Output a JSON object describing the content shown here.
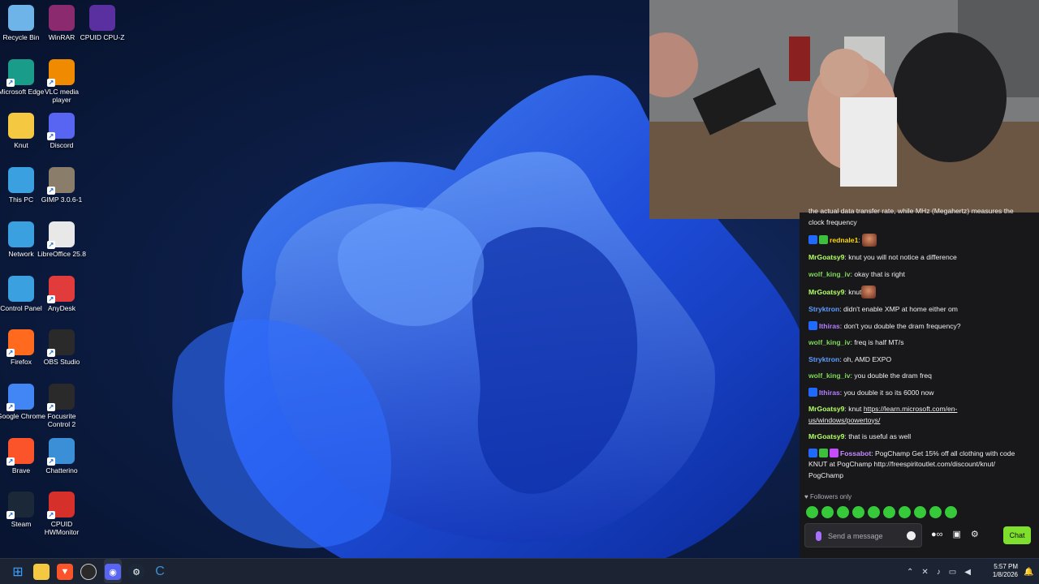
{
  "desktop": {
    "icons": [
      {
        "label": "Recycle Bin",
        "icon": "recycle-bin-icon",
        "color": "#6fb4e8"
      },
      {
        "label": "WinRAR",
        "icon": "winrar-icon",
        "color": "#8b2a6e"
      },
      {
        "label": "CPUID CPU-Z",
        "icon": "cpuz-icon",
        "color": "#5a2fa0"
      },
      {
        "label": "Microsoft Edge",
        "icon": "edge-icon",
        "color": "#1a9c8a"
      },
      {
        "label": "VLC media player",
        "icon": "vlc-icon",
        "color": "#f08a00"
      },
      {
        "label": "Knut",
        "icon": "folder-icon",
        "color": "#f5c842"
      },
      {
        "label": "Discord",
        "icon": "discord-icon",
        "color": "#5865f2"
      },
      {
        "label": "This PC",
        "icon": "monitor-icon",
        "color": "#3aa0e0"
      },
      {
        "label": "GIMP 3.0.6-1",
        "icon": "gimp-icon",
        "color": "#8a7e6a"
      },
      {
        "label": "Network",
        "icon": "network-icon",
        "color": "#3aa0e0"
      },
      {
        "label": "LibreOffice 25.8",
        "icon": "libreoffice-icon",
        "color": "#e8e8e8"
      },
      {
        "label": "Control Panel",
        "icon": "control-panel-icon",
        "color": "#3aa0e0"
      },
      {
        "label": "AnyDesk",
        "icon": "anydesk-icon",
        "color": "#e23b3b"
      },
      {
        "label": "Firefox",
        "icon": "firefox-icon",
        "color": "#ff6a1f"
      },
      {
        "label": "OBS Studio",
        "icon": "obs-icon",
        "color": "#2a2a2a"
      },
      {
        "label": "Google Chrome",
        "icon": "chrome-icon",
        "color": "#4285f4"
      },
      {
        "label": "Focusrite Control 2",
        "icon": "focusrite-icon",
        "color": "#2a2a2a"
      },
      {
        "label": "Brave",
        "icon": "brave-icon",
        "color": "#fb542b"
      },
      {
        "label": "Chatterino",
        "icon": "chatterino-icon",
        "color": "#3a8fd6"
      },
      {
        "label": "Steam",
        "icon": "steam-icon",
        "color": "#1b2838"
      },
      {
        "label": "CPUID HWMonitor",
        "icon": "hwmonitor-icon",
        "color": "#d6302a"
      }
    ]
  },
  "chat": {
    "messages": [
      {
        "user": "",
        "color": "#efeff1",
        "text": "the actual data transfer rate, while MHz (Megahertz) measures the clock frequency",
        "badges": 0,
        "emote": false
      },
      {
        "user": "rednale1",
        "color": "#ffd800",
        "text": "",
        "badges": 2,
        "emote": true
      },
      {
        "user": "MrGoatsy9",
        "color": "#b4ff64",
        "text": "knut you will not notice a difference",
        "badges": 0,
        "emote": false
      },
      {
        "user": "wolf_king_iv",
        "color": "#7ed957",
        "text": "okay that is right",
        "badges": 0,
        "emote": false
      },
      {
        "user": "MrGoatsy9",
        "color": "#b4ff64",
        "text": "knut",
        "badges": 0,
        "emote": true
      },
      {
        "user": "Stryktron",
        "color": "#5f9dff",
        "text": "didn't enable XMP at home either om",
        "badges": 0,
        "emote": false
      },
      {
        "user": "Ithiras",
        "color": "#b47dff",
        "text": "don't you double the dram frequency?",
        "badges": 1,
        "emote": false
      },
      {
        "user": "wolf_king_iv",
        "color": "#7ed957",
        "text": "freq is half MT/s",
        "badges": 0,
        "emote": false
      },
      {
        "user": "Stryktron",
        "color": "#5f9dff",
        "text": "oh, AMD EXPO",
        "badges": 0,
        "emote": false
      },
      {
        "user": "wolf_king_iv",
        "color": "#7ed957",
        "text": "you double the dram freq",
        "badges": 0,
        "emote": false
      },
      {
        "user": "Ithiras",
        "color": "#b47dff",
        "text": "you double it so its 6000 now",
        "badges": 1,
        "emote": false
      },
      {
        "user": "MrGoatsy9",
        "color": "#b4ff64",
        "text": "knut ",
        "link": "https://learn.microsoft.com/en-us/windows/powertoys/",
        "badges": 0,
        "emote": false
      },
      {
        "user": "MrGoatsy9",
        "color": "#b4ff64",
        "text": "that is useful as well",
        "badges": 0,
        "emote": false
      },
      {
        "user": "Fossabot",
        "color": "#c78bff",
        "text": "PogChamp Get 15% off all clothing with code KNUT at PogChamp http://freespiritoutlet.com/discount/knut/ PogChamp",
        "badges": 3,
        "emote": false
      }
    ],
    "followers_only": "Followers only",
    "input_placeholder": "Send a message",
    "chat_button": "Chat",
    "accent": "#7ee02c"
  },
  "taskbar": {
    "icons": [
      "windows-start-icon",
      "file-explorer-icon",
      "brave-icon",
      "obs-icon",
      "discord-icon",
      "steam-icon",
      "chatterino-icon"
    ],
    "time": "5:57 PM",
    "date": "1/8/2026"
  }
}
